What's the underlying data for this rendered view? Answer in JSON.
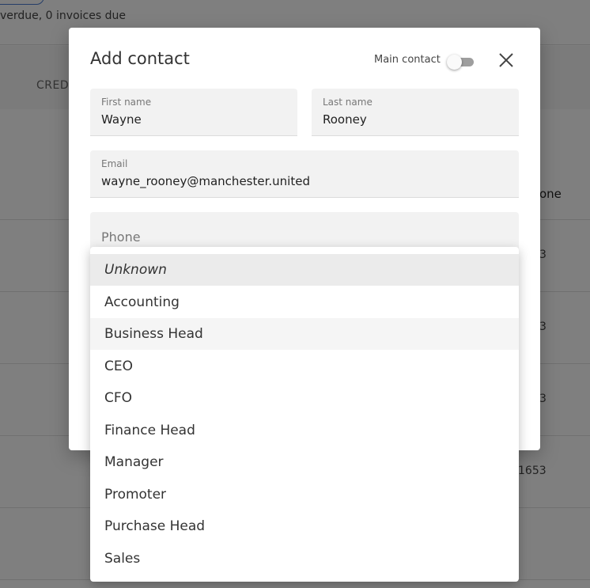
{
  "background": {
    "status_text": "verdue, 0 invoices due",
    "column_cred": "CRED",
    "column_phone": "one",
    "cells": [
      "3",
      "3",
      "3",
      "1653"
    ]
  },
  "modal": {
    "title": "Add contact",
    "main_contact_label": "Main contact",
    "main_contact_on": false,
    "close_icon": "close-icon",
    "fields": {
      "first_name": {
        "label": "First name",
        "value": "Wayne"
      },
      "last_name": {
        "label": "Last name",
        "value": "Rooney"
      },
      "email": {
        "label": "Email",
        "value": "wayne_rooney@manchester.united"
      },
      "phone": {
        "placeholder": "Phone"
      }
    }
  },
  "dropdown": {
    "selected": "Unknown",
    "options": [
      "Unknown",
      "Accounting",
      "Business Head",
      "CEO",
      "CFO",
      "Finance Head",
      "Manager",
      "Promoter",
      "Purchase Head",
      "Sales"
    ]
  },
  "colors": {
    "overlay": "rgba(0,0,0,0.5)",
    "field_bg": "#f2f2f2",
    "selected_bg": "#ebebeb",
    "hover_bg": "#f5f5f5"
  }
}
